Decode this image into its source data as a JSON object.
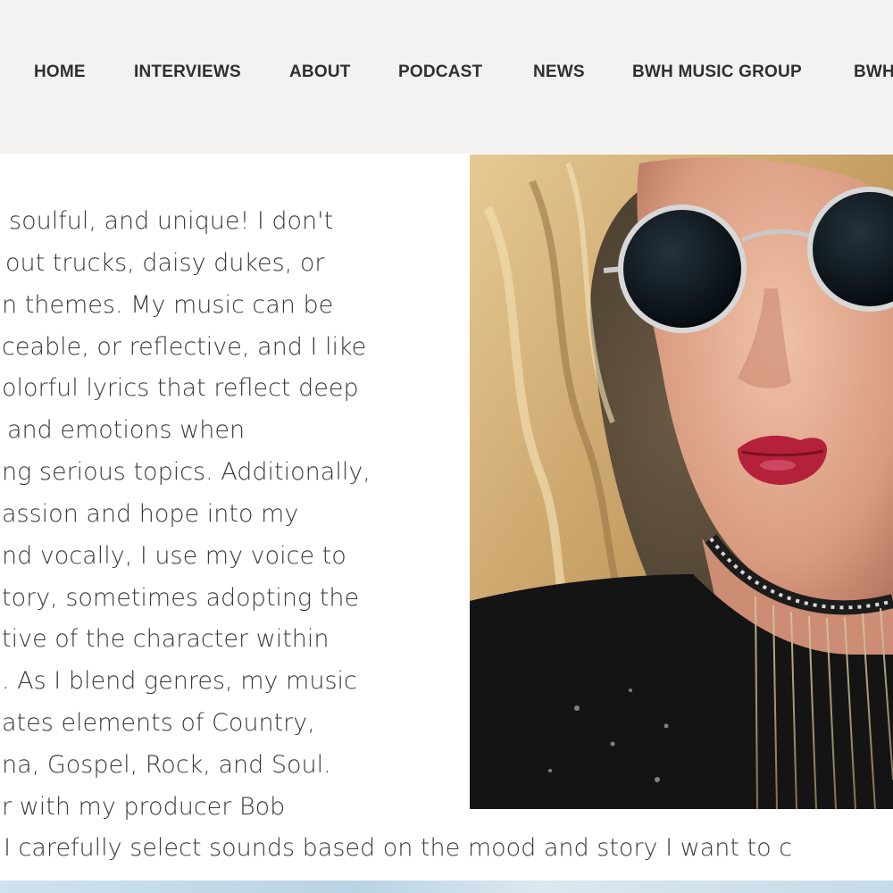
{
  "nav": {
    "items": [
      {
        "label": "HOME"
      },
      {
        "label": "INTERVIEWS"
      },
      {
        "label": "ABOUT"
      },
      {
        "label": "PODCAST"
      },
      {
        "label": "NEWS"
      },
      {
        "label": "BWH MUSIC GROUP"
      },
      {
        "label": "BWH"
      }
    ]
  },
  "article": {
    "lines": [
      "soulful, and unique! I don't",
      "out trucks, daisy dukes, or",
      "n themes. My music can be",
      "ceable, or reflective, and I like",
      "olorful lyrics that reflect deep",
      "and emotions when",
      "ng serious topics. Additionally,",
      "assion and hope into my",
      "nd vocally, I use my voice to",
      "tory, sometimes adopting the",
      "tive of the character within",
      ". As I blend genres, my music",
      "ates elements of Country,",
      "na, Gospel, Rock, and Soul.",
      "r with my producer Bob",
      "I carefully select sounds based on the mood and story I want to c"
    ]
  },
  "photo": {
    "subject": "woman with curly blonde hair wearing round dark sunglasses and red lipstick",
    "colors": {
      "hair": "#c9a46a",
      "skin": "#e0a98f",
      "lenses": "#0f1a22",
      "lips": "#b5213a",
      "clothing": "#141414"
    }
  }
}
